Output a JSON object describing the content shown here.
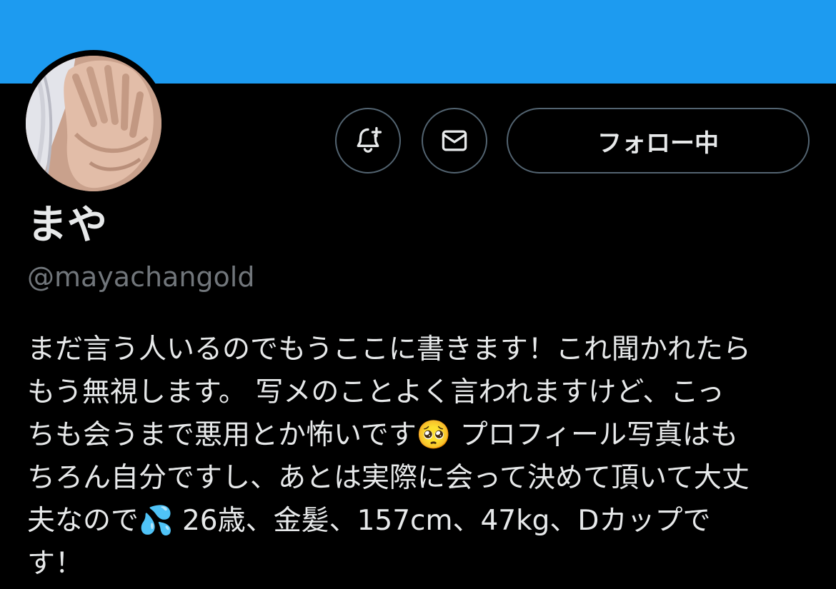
{
  "profile": {
    "display_name": "まや",
    "handle": "@mayachangold",
    "bio": "まだ言う人いるのでもうここに書きます！これ聞かれたら\nもう無視します。 写メのことよく言われますけど、こっ\nちも会うまで悪用とか怖いです🥺 プロフィール写真はも\nちろん自分ですし、あとは実際に会って決めて頂いて大丈\n夫なので💦 26歳、金髪、157cm、47kg、Dカップで\nす！"
  },
  "actions": {
    "follow_label": "フォロー中",
    "notify_icon": "bell-plus-icon",
    "dm_icon": "envelope-icon"
  },
  "colors": {
    "banner": "#1d9bf0",
    "background": "#000000",
    "text_primary": "#e7e9ea",
    "text_secondary": "#71767b",
    "button_border": "#536471"
  }
}
